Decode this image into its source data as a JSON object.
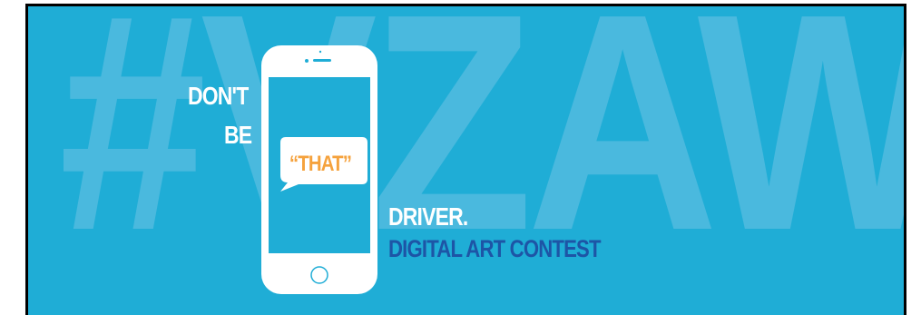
{
  "banner": {
    "hashtag": "#VZAW",
    "line1": "DON'T",
    "line2": "BE",
    "bubble_text": "“THAT”",
    "line3": "DRIVER.",
    "subtitle": "DIGITAL ART CONTEST"
  },
  "colors": {
    "background": "#1fadd6",
    "hashtag": "#4ab9de",
    "text": "#ffffff",
    "accent": "#f5a23d",
    "subtitle": "#1d55a6"
  },
  "icons": [
    "smartphone-icon",
    "speech-bubble-icon",
    "home-button-icon"
  ]
}
